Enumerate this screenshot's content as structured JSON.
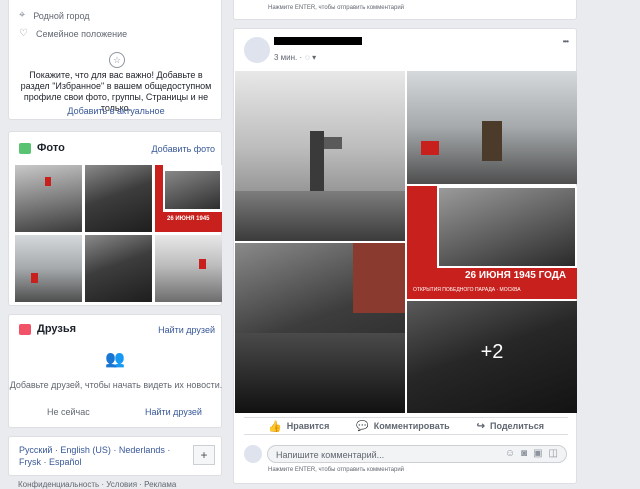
{
  "profile": {
    "hometown": "Родной город",
    "family": "Семейное положение",
    "featured_text": "Покажите, что для вас важно! Добавьте в раздел \"Избранное\" в вашем общедоступном профиле свои фото, группы, Страницы и не только.",
    "featured_link": "Добавить в актуальное"
  },
  "photos": {
    "title": "Фото",
    "add_label": "Добавить фото",
    "poster_date": "26 ИЮНЯ 1945"
  },
  "friends": {
    "title": "Друзья",
    "find_label": "Найти друзей",
    "empty_text": "Добавьте друзей, чтобы начать видеть их новости.",
    "not_now": "Не сейчас",
    "find_button": "Найти друзей"
  },
  "languages": {
    "list": "Русский · English (US) · Nederlands · Frysk · Español",
    "add": "+"
  },
  "footer_cut": "Конфиденциальность · Условия · Реклама",
  "top_comment_hint": "Нажмите ENTER, чтобы отправить комментарий",
  "post": {
    "time": "3 мин. ·",
    "more": "•••",
    "poster_title": "26 ИЮНЯ 1945 ГОДА",
    "poster_text": "ОТКРЫТИЯ ПОБЕДНОГО ПАРАДА · МОСКВА",
    "more_count": "+2",
    "like": "Нравится",
    "comment": "Комментировать",
    "share": "Поделиться",
    "comment_placeholder": "Напишите комментарий...",
    "enter_hint": "Нажмите ENTER, чтобы отправить комментарий"
  },
  "colors": {
    "link": "#385898",
    "flag": "#c8211d",
    "bg": "#e9ebee"
  }
}
